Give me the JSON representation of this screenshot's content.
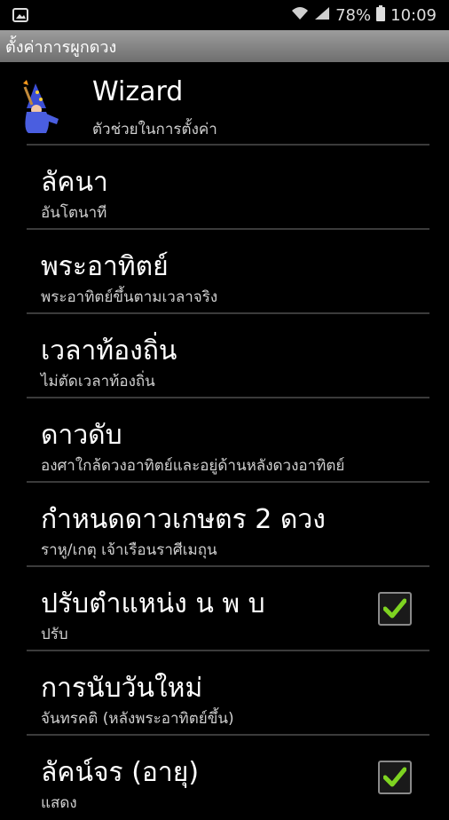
{
  "status": {
    "battery": "78%",
    "time": "10:09"
  },
  "title": "ตั้งค่าการผูกดวง",
  "items": [
    {
      "title": "Wizard",
      "subtitle": "ตัวช่วยในการตั้งค่า"
    },
    {
      "title": "ลัคนา",
      "subtitle": "อันโตนาที"
    },
    {
      "title": "พระอาทิตย์",
      "subtitle": "พระอาทิตย์ขึ้นตามเวลาจริง"
    },
    {
      "title": "เวลาท้องถิ่น",
      "subtitle": "ไม่ตัดเวลาท้องถิ่น"
    },
    {
      "title": "ดาวดับ",
      "subtitle": "องศาใกล้ดวงอาทิตย์และอยู่ด้านหลังดวงอาทิตย์"
    },
    {
      "title": "กำหนดดาวเกษตร 2 ดวง",
      "subtitle": "ราหู/เกตุ เจ้าเรือนราศีเมถุน"
    },
    {
      "title": "ปรับตำแหน่ง น พ บ",
      "subtitle": "ปรับ",
      "checked": true
    },
    {
      "title": "การนับวันใหม่",
      "subtitle": "จันทรคติ (หลังพระอาทิตย์ขึ้น)"
    },
    {
      "title": "ลัคน์จร (อายุ)",
      "subtitle": "แสดง",
      "checked": true
    }
  ],
  "colors": {
    "background": "#000000",
    "title_bar": "#8a8a8a",
    "check": "#7ed321"
  }
}
